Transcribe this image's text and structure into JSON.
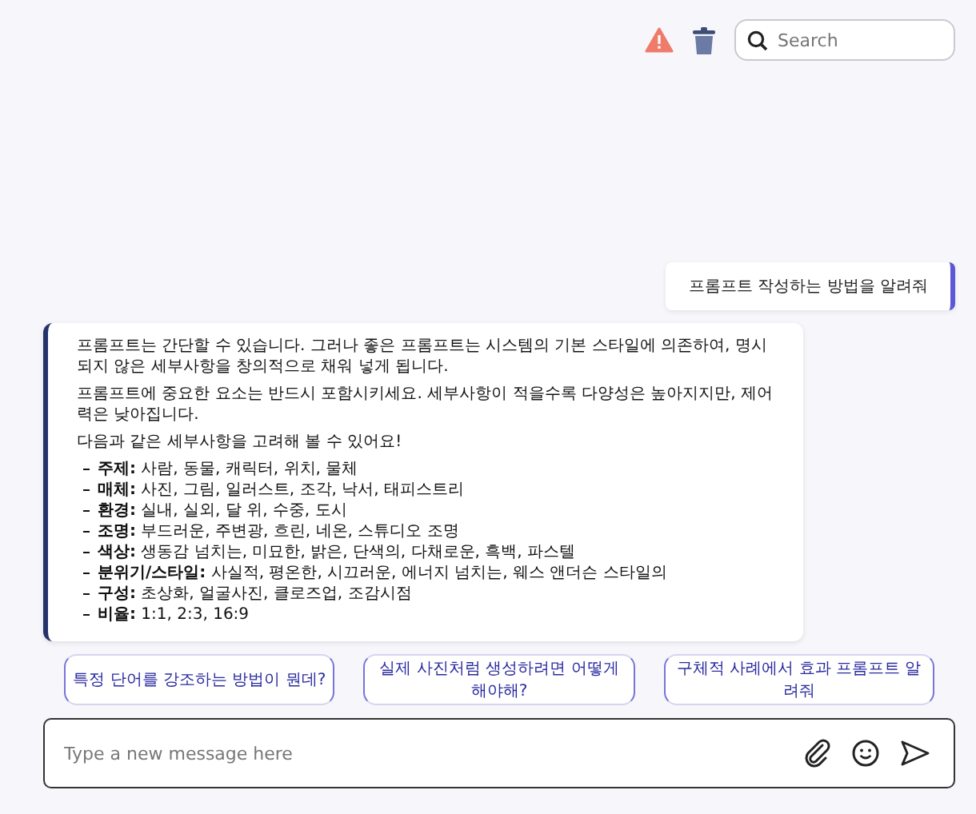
{
  "search": {
    "placeholder": "Search"
  },
  "messages": [
    {
      "kind": "user",
      "text": "프롬프트 작성하는 방법을 알려줘"
    },
    {
      "kind": "assistant",
      "paragraphs": [
        "프롬프트는 간단할 수 있습니다. 그러나 좋은 프롬프트는 시스템의 기본 스타일에 의존하여, 명시되지 않은 세부사항을 창의적으로 채워 넣게 됩니다.",
        "프롬프트에 중요한 요소는 반드시 포함시키세요. 세부사항이 적을수록 다양성은 높아지지만, 제어력은 낮아집니다.",
        "다음과 같은 세부사항을 고려해 볼 수 있어요!"
      ],
      "bullets": [
        {
          "label": "주제:",
          "text": "사람, 동물, 캐릭터, 위치, 물체"
        },
        {
          "label": "매체:",
          "text": "사진, 그림, 일러스트, 조각, 낙서, 태피스트리"
        },
        {
          "label": "환경:",
          "text": "실내, 실외, 달 위, 수중, 도시"
        },
        {
          "label": "조명:",
          "text": "부드러운, 주변광, 흐린, 네온, 스튜디오 조명"
        },
        {
          "label": "색상:",
          "text": "생동감 넘치는, 미묘한, 밝은, 단색의, 다채로운, 흑백, 파스텔"
        },
        {
          "label": "분위기/스타일:",
          "text": "사실적, 평온한, 시끄러운, 에너지 넘치는, 웨스 앤더슨 스타일의"
        },
        {
          "label": "구성:",
          "text": "초상화, 얼굴사진, 클로즈업, 조감시점"
        },
        {
          "label": "비율:",
          "text": "1:1, 2:3, 16:9"
        }
      ]
    }
  ],
  "suggestions": [
    "특정 단어를 강조하는 방법이 뭔데?",
    "실제 사진처럼 생성하려면 어떻게 해야해?",
    "구체적 사례에서 효과 프롬프트 알려줘"
  ],
  "composer": {
    "placeholder": "Type a new message here"
  }
}
